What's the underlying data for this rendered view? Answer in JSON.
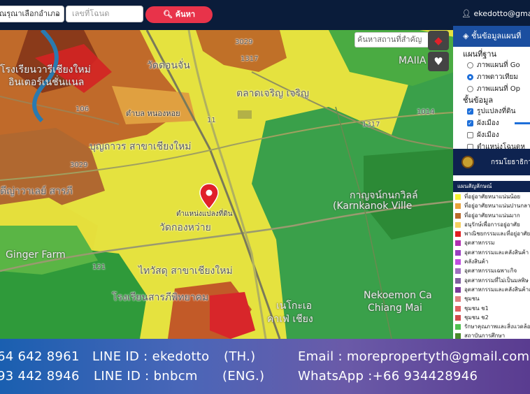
{
  "topbar": {
    "district_select": "ณรุณาเลือกอำเภอ",
    "deed_placeholder": "เลขที่โฉนด",
    "search_button": "ค้นหา",
    "user": "ekedotto@gma"
  },
  "map": {
    "place_search_placeholder": "ค้นหาสถานที่สำคัญ",
    "marker_label": "ตำแหน่งแปลงที่ดิน",
    "labels": {
      "school_top": "โรงเรียนวารีเชียงใหม่",
      "intersection": "อินเตอร์เนชั่นแนล",
      "wat_don_chan": "วัดดอนจั่น",
      "maiia": "MAIIA",
      "talad": "ตลาดเจริญ เจริญ",
      "tambon": "ตำบล หนองหอย",
      "bunthavorn": "บุญถาวร สาขาเชียงใหม่",
      "dipuvale": "ดีญ่าวาเลย์ สารภี",
      "karnkanok": "กาญจน์กนกวิลล์",
      "karnkanok_en": "(Karnkanok Ville",
      "wat_nong_hoi": "วัดกองหว่าย",
      "ginger": "Ginger Farm",
      "thaiwatsadu": "ไทวัสดุ สาขาเชียงใหม่",
      "school_bottom": "โรงเรียนสารภีพิทยาคม",
      "nekoemon": "Nekoemon Ca",
      "chiangmai": "Chiang Mai",
      "neko_th": "เนโกะเอ",
      "cafe": "คาเฟ่ เชียง",
      "road_3029_top": "3029",
      "road_1317": "1317",
      "road_106": "106",
      "road_11": "11",
      "road_3029_left": "3029",
      "road_1014": "1014",
      "road_1317b": "1317",
      "road_121": "121"
    }
  },
  "panel": {
    "title": "ชั้นข้อมูลแผนที่",
    "basemap_heading": "แผนที่ฐาน",
    "basemaps": [
      {
        "label": "ภาพแผนที่ Go",
        "on": false
      },
      {
        "label": "ภาพดาวเทียม",
        "on": true
      },
      {
        "label": "ภาพแผนที่ Op",
        "on": false
      }
    ],
    "layers_heading": "ชั้นข้อมูล",
    "layers": [
      {
        "label": "รูปแปลงที่ดิน",
        "on": true
      },
      {
        "label": "ผังเมือง",
        "on": true
      },
      {
        "label": "ผังเมือง",
        "on": false
      },
      {
        "label": "ตำแหน่งโฉนดห",
        "on": false
      }
    ],
    "department": "กรมโยธาธิการ",
    "legend_title": "แผนสัญลักษณ์",
    "legend": [
      {
        "label": "ที่อยู่อาศัยหนาแน่นน้อย",
        "color": "#f5f032"
      },
      {
        "label": "ที่อยู่อาศัยหนาแน่นปานกลาง",
        "color": "#e8a23a"
      },
      {
        "label": "ที่อยู่อาศัยหนาแน่นมาก",
        "color": "#b86a2a"
      },
      {
        "label": "อนุรักษ์เพื่อการอยู่อาศัย",
        "color": "#f5d060"
      },
      {
        "label": "พาณิชยกรรมและที่อยู่อาศัย",
        "color": "#e02020"
      },
      {
        "label": "อุตสาหกรรม",
        "color": "#b030b0"
      },
      {
        "label": "อุตสาหกรรมและคลังสินค้า",
        "color": "#9a40c0"
      },
      {
        "label": "คลังสินค้า",
        "color": "#c050e0"
      },
      {
        "label": "อุตสาหกรรมเฉพาะกิจ",
        "color": "#a070c0"
      },
      {
        "label": "อุตสาหกรรมที่ไม่เป็นมลพิษ",
        "color": "#8060a0"
      },
      {
        "label": "อุตสาหกรรมและคลังสินค้าเ",
        "color": "#7a3a9a"
      },
      {
        "label": "ชุมชน",
        "color": "#e08080"
      },
      {
        "label": "ชุมชน ช1",
        "color": "#e06060"
      },
      {
        "label": "ชุมชน ช2",
        "color": "#d04a4a"
      },
      {
        "label": "รักษาคุณภาพและสิ่งแวดล้อ",
        "color": "#50c050"
      },
      {
        "label": "สถาบันการศึกษา",
        "color": "#4a8a2a"
      }
    ]
  },
  "footer": {
    "phone_th": "64 642 8961",
    "line_th": "LINE ID : ekedotto",
    "tag_th": "(TH.)",
    "email": "Email : morepropertyth@gmail.com",
    "phone_en": "93 442 8946",
    "line_en": "LINE ID : bnbcm",
    "tag_en": "(ENG.)",
    "whatsapp": "WhatsApp :+66 934428946"
  }
}
